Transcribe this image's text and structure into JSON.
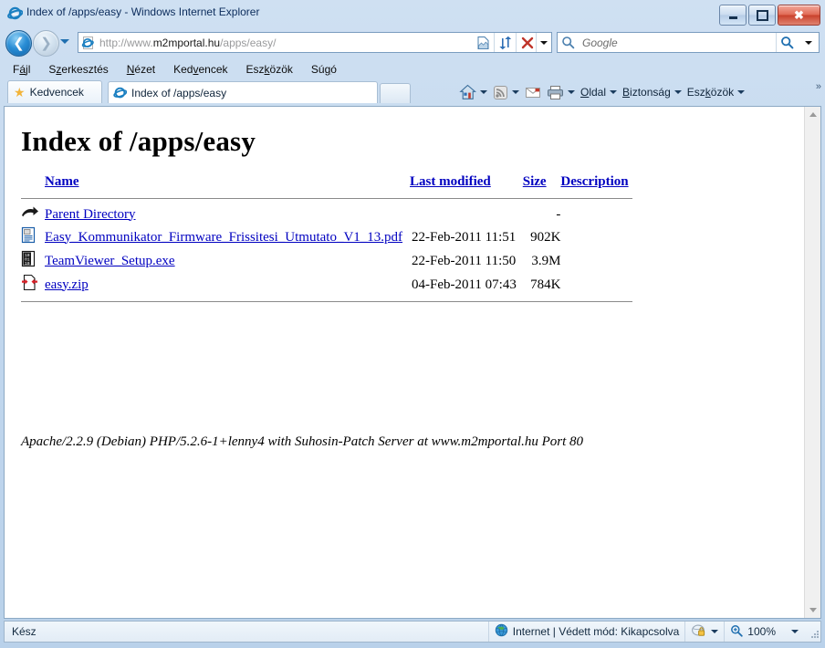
{
  "window": {
    "title": "Index of /apps/easy - Windows Internet Explorer",
    "minimize_label": "Minimize",
    "maximize_label": "Maximize",
    "close_label": "Close"
  },
  "navigation": {
    "back_label": "Back",
    "forward_label": "Forward",
    "history_label": "Recent Pages",
    "address_prefix": "http://www.",
    "address_host": "m2mportal.hu",
    "address_suffix": "/apps/easy/",
    "address_full": "http://www.m2mportal.hu/apps/easy/",
    "compat_label": "Compatibility View",
    "refresh_label": "Refresh",
    "stop_label": "Stop"
  },
  "search": {
    "placeholder": "Google",
    "value": "",
    "go_label": "Search",
    "provider_label": "Change search provider"
  },
  "menubar": {
    "items": [
      {
        "pre": "F",
        "accel": "á",
        "post": "jl",
        "label": "Fájl"
      },
      {
        "pre": "S",
        "accel": "z",
        "post": "erkesztés",
        "label": "Szerkesztés"
      },
      {
        "pre": "",
        "accel": "N",
        "post": "ézet",
        "label": "Nézet"
      },
      {
        "pre": "Ked",
        "accel": "v",
        "post": "encek",
        "label": "Kedvencek"
      },
      {
        "pre": "Esz",
        "accel": "k",
        "post": "özök",
        "label": "Eszközök"
      },
      {
        "pre": "Sú",
        "accel": "g",
        "post": "ó",
        "label": "Súgó"
      }
    ]
  },
  "favorites_bar": {
    "label": "Kedvencek"
  },
  "tabs": [
    {
      "label": "Index of /apps/easy",
      "active": true
    }
  ],
  "new_tab": {
    "label": ""
  },
  "command_bar": {
    "home_label": "Home",
    "feeds_label": "Feeds",
    "mail_label": "Read mail",
    "print_label": "Print",
    "items": [
      {
        "pre": "",
        "accel": "O",
        "post": "ldal",
        "label": "Oldal"
      },
      {
        "pre": "",
        "accel": "B",
        "post": "iztonság",
        "label": "Biztonság"
      },
      {
        "pre": "Esz",
        "accel": "k",
        "post": "özök",
        "label": "Eszközök"
      }
    ],
    "overflow_label": "»"
  },
  "page": {
    "heading": "Index of /apps/easy",
    "columns": {
      "icon": "",
      "name": "Name",
      "last_modified": "Last modified",
      "size": "Size",
      "description": "Description"
    },
    "rows": [
      {
        "icon": "parent-directory-icon",
        "name": "Parent Directory",
        "last_modified": "",
        "size": "-",
        "description": ""
      },
      {
        "icon": "document-file-icon",
        "name": "Easy_Kommunikator_Firmware_Frissitesi_Utmutato_V1_13.pdf",
        "last_modified": "22-Feb-2011 11:51",
        "size": "902K",
        "description": ""
      },
      {
        "icon": "binary-file-icon",
        "name": "TeamViewer_Setup.exe",
        "last_modified": "22-Feb-2011 11:50",
        "size": "3.9M",
        "description": ""
      },
      {
        "icon": "compressed-file-icon",
        "name": "easy.zip",
        "last_modified": "04-Feb-2011 07:43",
        "size": "784K",
        "description": ""
      }
    ],
    "server_signature": "Apache/2.2.9 (Debian) PHP/5.2.6-1+lenny4 with Suhosin-Patch Server at www.m2mportal.hu Port 80"
  },
  "scrollbar": {
    "up_label": "Scroll up",
    "down_label": "Scroll down"
  },
  "statusbar": {
    "status": "Kész",
    "zone": "Internet | Védett mód: Kikapcsolva",
    "zoom": "100%",
    "privacy_label": "Privacy report"
  },
  "colors": {
    "link": "#0000c0",
    "chrome_top": "#cfe0f2",
    "accent": "#1f6fb0",
    "close_button": "#c9412c"
  }
}
